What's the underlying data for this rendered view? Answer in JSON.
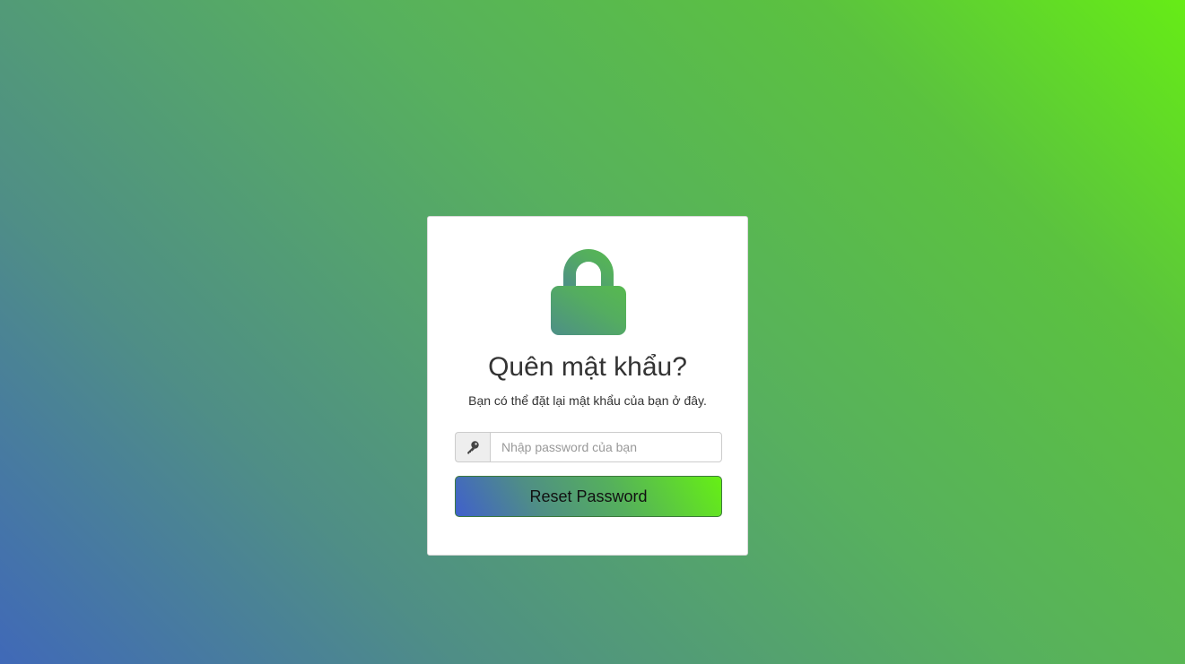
{
  "card": {
    "title": "Quên mật khẩu?",
    "subtitle": "Bạn có thể đặt lại mật khẩu của bạn ở đây.",
    "lock_icon": "lock-icon",
    "password_field": {
      "placeholder": "Nhập password của bạn",
      "value": "",
      "icon": "key-icon"
    },
    "reset_button_label": "Reset Password"
  },
  "colors": {
    "gradient_start": "#4069b8",
    "gradient_mid": "#57b05e",
    "gradient_end": "#66ec16",
    "text": "#333333"
  }
}
